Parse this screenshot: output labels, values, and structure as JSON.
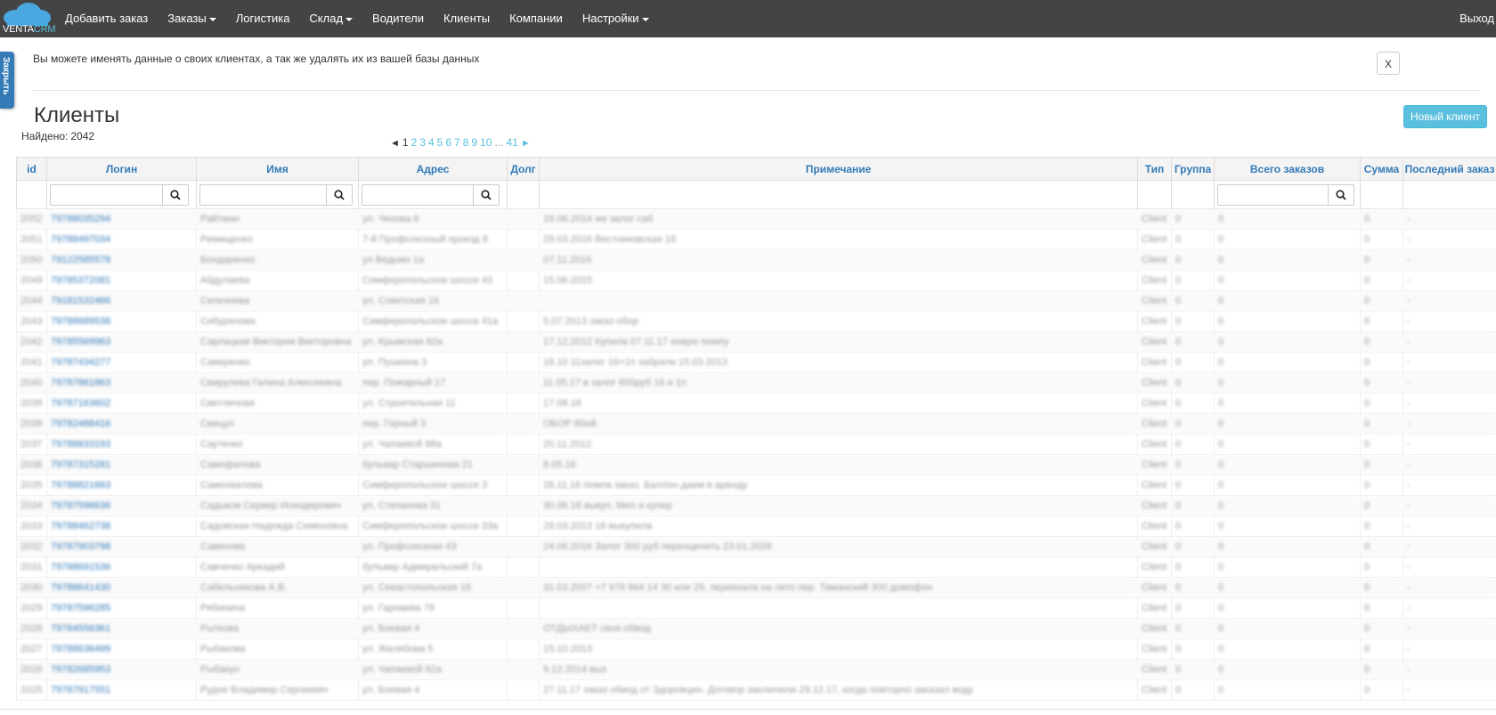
{
  "navbar": {
    "logo_text_1": "VENTA",
    "logo_text_2": "CRM",
    "items": [
      {
        "label": "Добавить заказ",
        "caret": false
      },
      {
        "label": "Заказы",
        "caret": true
      },
      {
        "label": "Логистика",
        "caret": false
      },
      {
        "label": "Склад",
        "caret": true
      },
      {
        "label": "Водители",
        "caret": false
      },
      {
        "label": "Клиенты",
        "caret": false
      },
      {
        "label": "Компании",
        "caret": false
      },
      {
        "label": "Настройки",
        "caret": true
      }
    ],
    "logout": "Выход"
  },
  "side_tab": "Закрыть",
  "info": {
    "text": "Вы можете именять данные о своих клиентах, а так же удалять их из вашей базы данных",
    "close_label": "X"
  },
  "page": {
    "title": "Клиенты",
    "found_label": "Найдено:",
    "found_count": "2042",
    "new_client_label": "Новый клиент"
  },
  "pagination": {
    "prev": "◄",
    "current": "1",
    "pages": [
      "2",
      "3",
      "4",
      "5",
      "6",
      "7",
      "8",
      "9",
      "10"
    ],
    "ellipsis": "...",
    "last": "41",
    "next": "►"
  },
  "table": {
    "columns": [
      "id",
      "Логин",
      "Имя",
      "Адрес",
      "Долг",
      "Примечание",
      "Тип",
      "Группа",
      "Всего заказов",
      "Сумма",
      "Последний заказ"
    ],
    "rows": [
      [
        "2052",
        "79788035294",
        "Райтман",
        "ул. Чехова 6",
        "",
        "18.06.2014 же залог саб",
        "Client",
        "0",
        "0",
        "0",
        "-"
      ],
      [
        "2051",
        "79788497034",
        "Ремищенко",
        "7-й Профсоюзный проезд 8",
        "",
        "29.03.2016 Вестниковская 18",
        "Client",
        "0",
        "0",
        "0",
        "-"
      ],
      [
        "2050",
        "79122585578",
        "Бондаренко",
        "ул Ведьмо 1а",
        "",
        "07.11.2016",
        "Client",
        "0",
        "0",
        "0",
        "-"
      ],
      [
        "2049",
        "79785372081",
        "Абдулаева",
        "Симферопольское шоссе 43",
        "",
        "15.06.2015",
        "Client",
        "0",
        "0",
        "0",
        "-"
      ],
      [
        "2044",
        "79181532466",
        "Селезнева",
        "ул. Советская 16",
        "",
        "",
        "Client",
        "0",
        "0",
        "0",
        "-"
      ],
      [
        "2043",
        "79788689538",
        "Сибуренова",
        "Симферопольское шоссе 41а",
        "",
        "5.07.2013 заказ обор",
        "Client",
        "0",
        "0",
        "0",
        "-"
      ],
      [
        "2042",
        "79785569963",
        "Сарлацкая Виктория Викторовна",
        "ул. Крымская 82а",
        "",
        "17.12.2012 Купила 07.11.17 новую помпу",
        "Client",
        "0",
        "0",
        "0",
        "-"
      ],
      [
        "2041",
        "79787434277",
        "Саверенко",
        "ул. Пушкина 3",
        "",
        "18.10 11залог 16+1п забрали 15.03.2013",
        "Client",
        "0",
        "0",
        "0",
        "-"
      ],
      [
        "2040",
        "79787861863",
        "Свирулева Галина Алексеевна",
        "пер. Пожарный 17",
        "",
        "11.05.17 в залог 600руб 16 и 1п",
        "Client",
        "0",
        "0",
        "0",
        "-"
      ],
      [
        "2039",
        "79787163602",
        "Светличная",
        "ул. Строительная 11",
        "",
        "17.08.16",
        "Client",
        "0",
        "0",
        "0",
        "-"
      ],
      [
        "2038",
        "79782488416",
        "Свицул",
        "пер. Горный 3",
        "",
        "ОБОР 8бой.",
        "Client",
        "0",
        "0",
        "0",
        "-"
      ],
      [
        "2037",
        "79788833193",
        "Саутенко",
        "ул. Чапаевой 88а",
        "",
        "20.11.2012",
        "Client",
        "0",
        "0",
        "0",
        "-"
      ],
      [
        "2036",
        "79787315281",
        "Самофалова",
        "бульвар Старшинова 21",
        "",
        "8.05.16",
        "Client",
        "0",
        "0",
        "0",
        "-"
      ],
      [
        "2035",
        "79788821663",
        "Самохвалова",
        "Симферопольское шоссе 3",
        "",
        "26.11.16 помпа заказ. Баллон даем в аренду",
        "Client",
        "0",
        "0",
        "0",
        "-"
      ],
      [
        "2034",
        "79787596636",
        "Садыков Сервер Исендерович",
        "ул. Степанова 31",
        "",
        "30.06.16 выкуп. Мил и купер",
        "Client",
        "0",
        "0",
        "0",
        "-"
      ],
      [
        "2033",
        "79788462738",
        "Садовская Надежда Семеновна",
        "Симферопольское шоссе 33а",
        "",
        "29.03.2013 16 выкупила",
        "Client",
        "0",
        "0",
        "0",
        "-"
      ],
      [
        "2032",
        "79787903798",
        "Савенова",
        "ул. Профсоюзная 43",
        "",
        "24.06.2016 Залог 300 руб переоценить 23.01.2026",
        "Client",
        "0",
        "0",
        "0",
        "-"
      ],
      [
        "2031",
        "79788691536",
        "Савченко Аркадий",
        "бульвар Адмиральский 7а",
        "",
        "",
        "Client",
        "0",
        "0",
        "0",
        "-"
      ],
      [
        "2030",
        "79788641430",
        "Сабельникова А.В.",
        "ул. Севастопольская 16",
        "",
        "31.03.2007 +7 978 864 14 30 или 29, переехала на лето пер. Таманский 300 домофон",
        "Client",
        "0",
        "0",
        "0",
        "-"
      ],
      [
        "2029",
        "79787596285",
        "Рябинина",
        "ул. Гарнаева 79",
        "",
        "",
        "Client",
        "0",
        "0",
        "0",
        "-"
      ],
      [
        "2028",
        "79784556361",
        "Рыткова",
        "ул. Боевая 4",
        "",
        "ОТДЫХАЕТ своя обвод",
        "Client",
        "0",
        "0",
        "0",
        "-"
      ],
      [
        "2027",
        "79788636499",
        "Рыбакова",
        "ул. Желябова 5",
        "",
        "15.10.2013",
        "Client",
        "0",
        "0",
        "0",
        "-"
      ],
      [
        "2026",
        "79782685953",
        "Рыбакун",
        "ул. Чапаевой 82а",
        "",
        "9.12.2014 выз",
        "Client",
        "0",
        "0",
        "0",
        "-"
      ],
      [
        "2025",
        "79787917551",
        "Рудое Владимир Сергеевич",
        "ул. Боевая 4",
        "",
        "27.11.17 заказ обвод от Здоровцин. Договор заключили 29.12.17, когда повторно заказал воду",
        "Client",
        "0",
        "0",
        "0",
        "-"
      ]
    ]
  }
}
